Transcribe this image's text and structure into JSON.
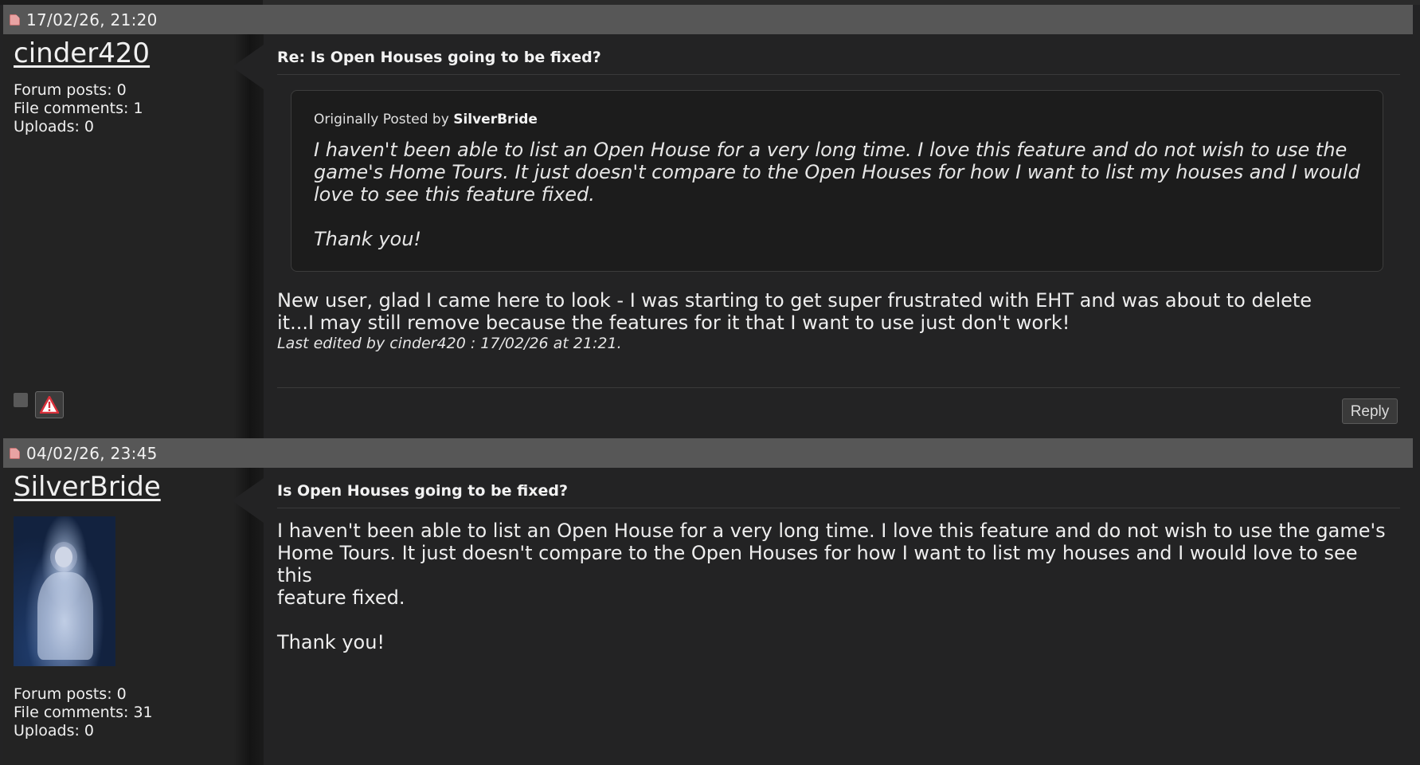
{
  "posts": [
    {
      "timestamp": "17/02/26, 21:20",
      "username": "cinder420",
      "stats": {
        "forum_posts": "Forum posts: 0",
        "file_comments": "File comments: 1",
        "uploads": "Uploads: 0"
      },
      "title": "Re: Is Open Houses going to be fixed?",
      "quote": {
        "prefix": "Originally Posted by ",
        "author": "SilverBride",
        "line1": "I haven't been able to list an Open House for a very long time. I love this feature and do not wish to use the",
        "line2": "game's Home Tours. It just doesn't compare to the Open Houses for how I want to list my houses and I would",
        "line3": "love to see this feature fixed.",
        "line4": "Thank you!"
      },
      "body": {
        "line1": "New user, glad I came here to look - I was starting to get super frustrated with EHT and was about to delete",
        "line2": "it...I may still remove because the features for it that I want to use just don't work!"
      },
      "edited": "Last edited by cinder420 : 17/02/26 at 21:21.",
      "reply_label": "Reply"
    },
    {
      "timestamp": "04/02/26, 23:45",
      "username": "SilverBride",
      "stats": {
        "forum_posts": "Forum posts: 0",
        "file_comments": "File comments: 31",
        "uploads": "Uploads: 0"
      },
      "title": "Is Open Houses going to be fixed?",
      "body": {
        "line1": "I haven't been able to list an Open House for a very long time. I love this feature and do not wish to use the game's",
        "line2": "Home Tours. It just doesn't compare to the Open Houses for how I want to list my houses and I would love to see this",
        "line3": "feature fixed.",
        "line4": "Thank you!"
      }
    }
  ],
  "colors": {
    "header_bar": "#575757",
    "background": "#232324",
    "quote_bg": "#1c1c1c"
  }
}
